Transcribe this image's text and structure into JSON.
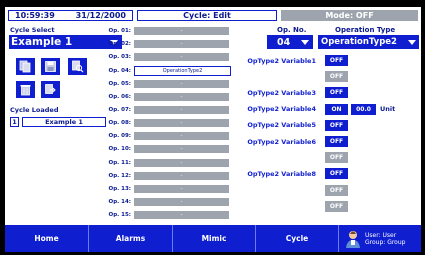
{
  "header": {
    "time": "10:59:39",
    "date": "31/12/2000",
    "cycle_status": "Cycle: Edit",
    "mode": "Mode: OFF"
  },
  "cycle_select": {
    "label": "Cycle Select",
    "value": "Example 1"
  },
  "cycle_loaded": {
    "label": "Cycle Loaded",
    "number": "1",
    "name": "Example 1"
  },
  "ops": [
    {
      "label": "Op. 01:",
      "value": "-"
    },
    {
      "label": "Op. 02:",
      "value": "-"
    },
    {
      "label": "Op. 03:",
      "value": "-"
    },
    {
      "label": "Op. 04:",
      "value": "OperationType2"
    },
    {
      "label": "Op. 05:",
      "value": "-"
    },
    {
      "label": "Op. 06:",
      "value": "-"
    },
    {
      "label": "Op. 07:",
      "value": "-"
    },
    {
      "label": "Op. 08:",
      "value": "-"
    },
    {
      "label": "Op. 09:",
      "value": "-"
    },
    {
      "label": "Op. 10:",
      "value": "-"
    },
    {
      "label": "Op. 11:",
      "value": "-"
    },
    {
      "label": "Op. 12:",
      "value": "-"
    },
    {
      "label": "Op. 13:",
      "value": "-"
    },
    {
      "label": "Op. 14:",
      "value": "-"
    },
    {
      "label": "Op. 15:",
      "value": "-"
    }
  ],
  "op_no": {
    "label": "Op. No.",
    "value": "04"
  },
  "op_type": {
    "label": "Operation Type",
    "value": "OperationType2"
  },
  "variables": [
    {
      "label": "OpType2 Variable1",
      "state": "OFF"
    },
    {
      "label": "",
      "state": "OFF"
    },
    {
      "label": "OpType2 Variable3",
      "state": "OFF"
    },
    {
      "label": "OpType2 Variable4",
      "state": "ON",
      "value": "00.0",
      "unit": "Unit"
    },
    {
      "label": "OpType2 Variable5",
      "state": "OFF"
    },
    {
      "label": "OpType2 Variable6",
      "state": "OFF"
    },
    {
      "label": "",
      "state": "OFF"
    },
    {
      "label": "OpType2 Variable8",
      "state": "OFF"
    },
    {
      "label": "",
      "state": "OFF"
    },
    {
      "label": "",
      "state": "OFF"
    }
  ],
  "nav": {
    "home": "Home",
    "alarms": "Alarms",
    "mimic": "Mimic",
    "cycle": "Cycle"
  },
  "user": {
    "user": "User: User",
    "group": "Group: Group"
  },
  "colors": {
    "accent": "#0f1fd0",
    "disabled": "#9ea4ad",
    "text": "#0b1a8f"
  }
}
